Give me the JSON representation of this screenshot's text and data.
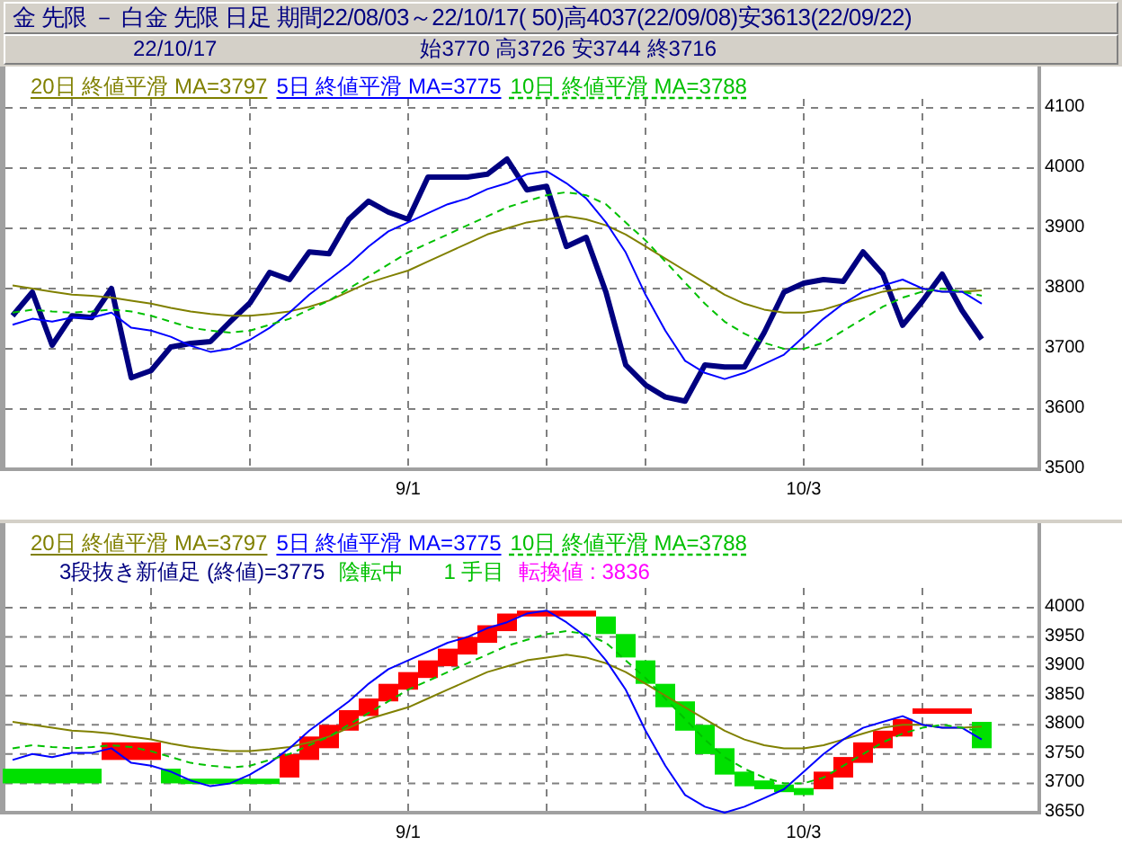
{
  "header": {
    "title": "金 先限 － 白金 先限 日足 期間22/08/03～22/10/17( 50)高4037(22/09/08)安3613(22/09/22)",
    "date": "22/10/17",
    "ohlc": "始3770 高3726 安3744 終3716"
  },
  "main_chart": {
    "x_labels": [
      {
        "text": "9/1"
      },
      {
        "text": "10/3"
      }
    ],
    "chart_data": {
      "type": "line",
      "grid": true,
      "ylim": [
        3500,
        4100
      ],
      "yticks": [
        {
          "value": 3500,
          "label": "3500"
        },
        {
          "value": 3600,
          "label": "3600"
        },
        {
          "value": 3700,
          "label": "3700"
        },
        {
          "value": 3800,
          "label": "3800"
        },
        {
          "value": 3900,
          "label": "3900"
        },
        {
          "value": 4000,
          "label": "4000"
        },
        {
          "value": 4100,
          "label": "4100"
        }
      ],
      "series": [
        {
          "color": "#000080",
          "line_style": "solid",
          "values": [
            3755,
            3794,
            3706,
            3755,
            3752,
            3800,
            3652,
            3664,
            3703,
            3709,
            3712,
            3745,
            3776,
            3827,
            3815,
            3861,
            3858,
            3915,
            3945,
            3927,
            3915,
            3985,
            3985,
            3985,
            3990,
            4015,
            3964,
            3970,
            3870,
            3885,
            3794,
            3673,
            3640,
            3620,
            3613,
            3673,
            3670,
            3670,
            3727,
            3794,
            3809,
            3815,
            3812,
            3861,
            3824,
            3739,
            3779,
            3824,
            3764,
            3716
          ]
        },
        {
          "name": "20日 終値平滑 MA=3797",
          "color": "#808000",
          "line_style": "solid",
          "values": [
            3805,
            3800,
            3795,
            3790,
            3788,
            3785,
            3780,
            3775,
            3768,
            3762,
            3758,
            3755,
            3755,
            3758,
            3762,
            3770,
            3780,
            3795,
            3810,
            3820,
            3830,
            3845,
            3860,
            3875,
            3890,
            3900,
            3910,
            3915,
            3920,
            3915,
            3905,
            3890,
            3870,
            3850,
            3830,
            3810,
            3790,
            3775,
            3765,
            3760,
            3760,
            3765,
            3775,
            3785,
            3795,
            3800,
            3800,
            3795,
            3795,
            3797
          ]
        },
        {
          "name": "5日 終値平滑 MA=3775",
          "color": "#0000ff",
          "line_style": "solid",
          "values": [
            3740,
            3750,
            3745,
            3752,
            3752,
            3760,
            3735,
            3730,
            3720,
            3705,
            3695,
            3700,
            3715,
            3735,
            3760,
            3790,
            3815,
            3840,
            3870,
            3895,
            3910,
            3925,
            3940,
            3950,
            3965,
            3975,
            3990,
            3995,
            3975,
            3950,
            3910,
            3860,
            3790,
            3730,
            3680,
            3660,
            3650,
            3660,
            3675,
            3690,
            3720,
            3750,
            3775,
            3795,
            3805,
            3815,
            3800,
            3795,
            3795,
            3775
          ]
        },
        {
          "name": "10日 終値平滑 MA=3788",
          "color": "#00c000",
          "line_style": "dashed",
          "values": [
            3760,
            3765,
            3762,
            3760,
            3762,
            3765,
            3762,
            3755,
            3745,
            3735,
            3730,
            3727,
            3730,
            3740,
            3750,
            3765,
            3780,
            3800,
            3820,
            3840,
            3860,
            3875,
            3890,
            3905,
            3920,
            3935,
            3945,
            3955,
            3960,
            3955,
            3940,
            3910,
            3880,
            3845,
            3810,
            3775,
            3745,
            3725,
            3710,
            3700,
            3700,
            3710,
            3730,
            3750,
            3770,
            3785,
            3795,
            3800,
            3795,
            3788
          ]
        }
      ]
    }
  },
  "sub_chart": {
    "status": [
      {
        "text": "3段抜き新値足 (終値)=3775",
        "color": "#000080"
      },
      {
        "text": "陰転中",
        "color": "#00c000"
      },
      {
        "text": "1 手目",
        "color": "#00c000"
      },
      {
        "text": "転換値 : 3836",
        "color": "#ff00ff"
      }
    ],
    "x_labels": [
      {
        "text": "9/1"
      },
      {
        "text": "10/3"
      }
    ],
    "chart_data": {
      "type": "candlestick",
      "grid": true,
      "ylim": [
        3650,
        4000
      ],
      "yticks": [
        {
          "value": 3650,
          "label": "3650"
        },
        {
          "value": 3700,
          "label": "3700"
        },
        {
          "value": 3750,
          "label": "3750"
        },
        {
          "value": 3800,
          "label": "3800"
        },
        {
          "value": 3850,
          "label": "3850"
        },
        {
          "value": 3900,
          "label": "3900"
        },
        {
          "value": 3950,
          "label": "3950"
        },
        {
          "value": 4000,
          "label": "4000"
        }
      ],
      "series": [
        {
          "color": "#ff0000",
          "ohlc": [
            null,
            null,
            null,
            null,
            null,
            [
              3740,
              3770,
              3740,
              3770
            ],
            [
              3740,
              3770,
              3740,
              3770
            ],
            [
              3740,
              3770,
              3740,
              3770
            ],
            null,
            null,
            null,
            null,
            null,
            null,
            [
              3710,
              3750,
              3710,
              3750
            ],
            [
              3740,
              3780,
              3740,
              3780
            ],
            [
              3760,
              3800,
              3760,
              3800
            ],
            [
              3790,
              3825,
              3790,
              3825
            ],
            [
              3815,
              3845,
              3815,
              3845
            ],
            [
              3840,
              3870,
              3840,
              3870
            ],
            [
              3860,
              3890,
              3860,
              3890
            ],
            [
              3880,
              3910,
              3880,
              3910
            ],
            [
              3900,
              3930,
              3900,
              3930
            ],
            [
              3920,
              3950,
              3920,
              3950
            ],
            [
              3940,
              3970,
              3940,
              3970
            ],
            [
              3960,
              3990,
              3960,
              3990
            ],
            [
              3985,
              3995,
              3985,
              3995
            ],
            [
              3985,
              3995,
              3985,
              3995
            ],
            [
              3985,
              3995,
              3985,
              3995
            ],
            [
              3985,
              3995,
              3985,
              3995
            ],
            null,
            null,
            null,
            null,
            null,
            null,
            null,
            null,
            null,
            null,
            null,
            [
              3690,
              3720,
              3690,
              3720
            ],
            [
              3710,
              3745,
              3710,
              3745
            ],
            [
              3735,
              3770,
              3735,
              3770
            ],
            [
              3760,
              3790,
              3760,
              3790
            ],
            [
              3780,
              3810,
              3780,
              3810
            ],
            [
              3820,
              3828,
              3820,
              3828
            ],
            [
              3820,
              3828,
              3820,
              3828
            ],
            [
              3820,
              3828,
              3820,
              3828
            ],
            null
          ]
        },
        {
          "color": "#00e000",
          "ohlc": [
            [
              3725,
              3725,
              3700,
              3700
            ],
            [
              3725,
              3725,
              3700,
              3700
            ],
            [
              3725,
              3725,
              3700,
              3700
            ],
            [
              3725,
              3725,
              3700,
              3700
            ],
            [
              3725,
              3725,
              3700,
              3700
            ],
            null,
            null,
            null,
            [
              3725,
              3725,
              3700,
              3700
            ],
            [
              3708,
              3708,
              3700,
              3700
            ],
            [
              3708,
              3708,
              3700,
              3700
            ],
            [
              3708,
              3708,
              3700,
              3700
            ],
            [
              3708,
              3708,
              3700,
              3700
            ],
            [
              3708,
              3708,
              3700,
              3700
            ],
            null,
            null,
            null,
            null,
            null,
            null,
            null,
            null,
            null,
            null,
            null,
            null,
            null,
            null,
            null,
            null,
            [
              3985,
              3985,
              3955,
              3955
            ],
            [
              3955,
              3955,
              3915,
              3915
            ],
            [
              3910,
              3910,
              3870,
              3870
            ],
            [
              3870,
              3870,
              3830,
              3830
            ],
            [
              3840,
              3840,
              3790,
              3790
            ],
            [
              3800,
              3800,
              3750,
              3750
            ],
            [
              3760,
              3760,
              3715,
              3715
            ],
            [
              3720,
              3720,
              3695,
              3695
            ],
            [
              3705,
              3705,
              3690,
              3690
            ],
            [
              3698,
              3698,
              3685,
              3685
            ],
            [
              3692,
              3692,
              3680,
              3680
            ],
            null,
            null,
            null,
            null,
            null,
            null,
            null,
            null,
            [
              3805,
              3805,
              3760,
              3760
            ]
          ]
        },
        {
          "type": "line",
          "name": "20日 終値平滑 MA=3797",
          "color": "#808000",
          "line_style": "solid",
          "values": [
            3805,
            3800,
            3795,
            3790,
            3788,
            3785,
            3780,
            3775,
            3768,
            3762,
            3758,
            3755,
            3755,
            3758,
            3762,
            3770,
            3780,
            3795,
            3810,
            3820,
            3830,
            3845,
            3860,
            3875,
            3890,
            3900,
            3910,
            3915,
            3920,
            3915,
            3905,
            3890,
            3870,
            3850,
            3830,
            3810,
            3790,
            3775,
            3765,
            3760,
            3760,
            3765,
            3775,
            3785,
            3795,
            3800,
            3800,
            3795,
            3795,
            3797
          ]
        },
        {
          "type": "line",
          "name": "5日 終値平滑 MA=3775",
          "color": "#0000ff",
          "line_style": "solid",
          "values": [
            3740,
            3750,
            3745,
            3752,
            3752,
            3760,
            3735,
            3730,
            3720,
            3705,
            3695,
            3700,
            3715,
            3735,
            3760,
            3790,
            3815,
            3840,
            3870,
            3895,
            3910,
            3925,
            3940,
            3950,
            3965,
            3975,
            3990,
            3995,
            3975,
            3950,
            3910,
            3860,
            3790,
            3730,
            3680,
            3660,
            3650,
            3660,
            3675,
            3690,
            3720,
            3750,
            3775,
            3795,
            3805,
            3815,
            3800,
            3795,
            3795,
            3775
          ]
        },
        {
          "type": "line",
          "name": "10日 終値平滑 MA=3788",
          "color": "#00c000",
          "line_style": "dashed",
          "values": [
            3760,
            3765,
            3762,
            3760,
            3762,
            3765,
            3762,
            3755,
            3745,
            3735,
            3730,
            3727,
            3730,
            3740,
            3750,
            3765,
            3780,
            3800,
            3820,
            3840,
            3860,
            3875,
            3890,
            3905,
            3920,
            3935,
            3945,
            3955,
            3960,
            3955,
            3940,
            3910,
            3880,
            3845,
            3810,
            3775,
            3745,
            3725,
            3710,
            3700,
            3700,
            3710,
            3730,
            3750,
            3770,
            3785,
            3795,
            3800,
            3795,
            3788
          ]
        }
      ]
    }
  }
}
